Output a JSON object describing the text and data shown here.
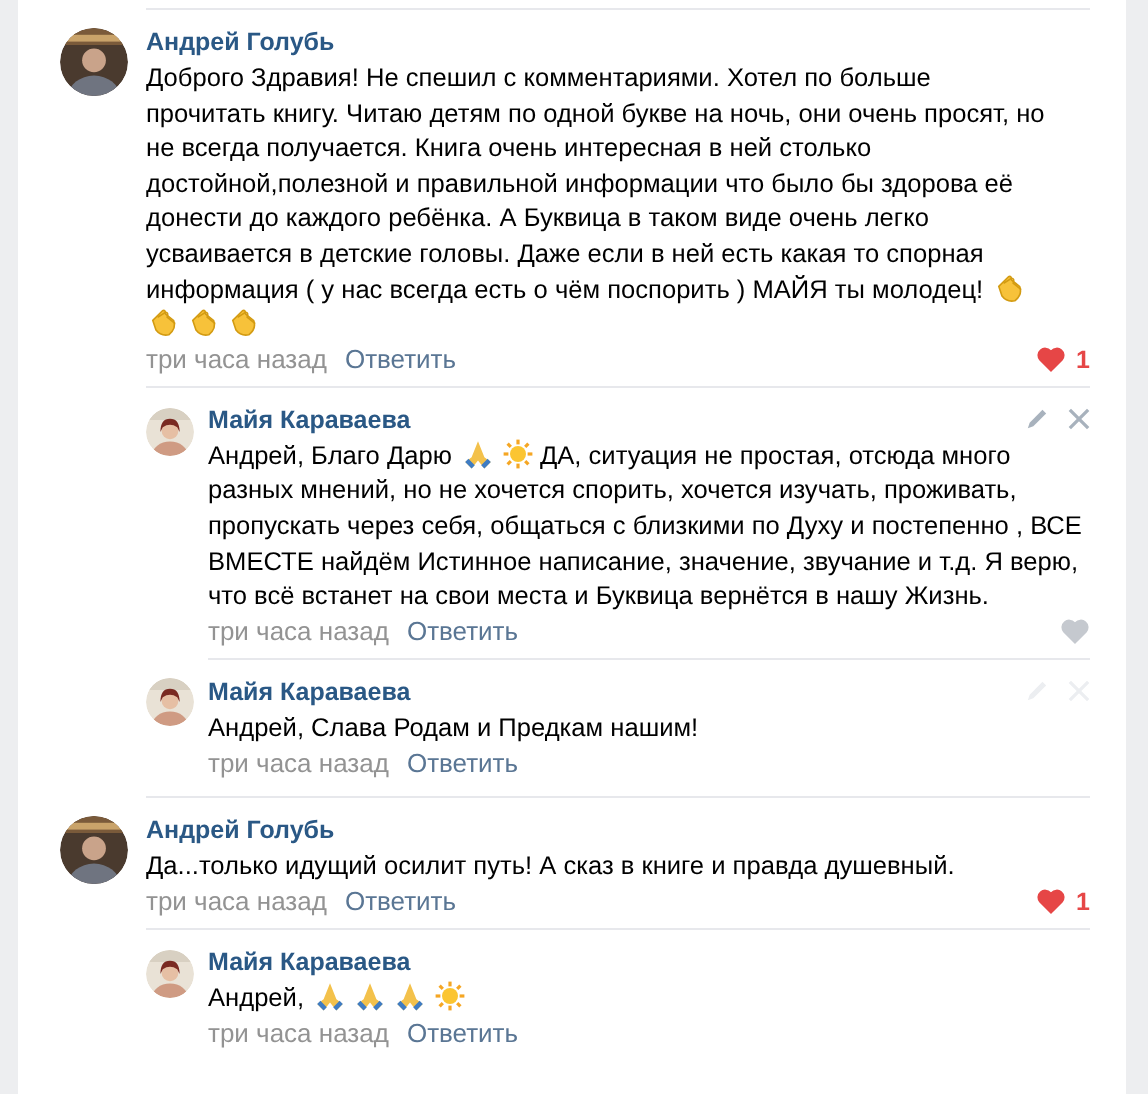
{
  "comments": [
    {
      "author": "Андрей Голубь",
      "body": [
        {
          "kind": "text",
          "text": "Доброго Здравия! Не спешил с комментариями. Хотел по больше прочитать книгу. Читаю детям по одной букве на ночь, они очень просят, но не всегда получается. Книга очень интересная в ней столько достойной,полезной и правильной информации что было бы здорова её донести до каждого ребёнка. А Буквица в таком виде очень легко усваивается в детские головы. Даже если в ней есть какая то спорная"
        },
        {
          "kind": "line",
          "text": "информация ( у нас всегда есть о чём поспорить ) МАЙЯ ты молодец!"
        },
        {
          "kind": "clap"
        },
        {
          "kind": "clap"
        },
        {
          "kind": "clap"
        },
        {
          "kind": "clap"
        }
      ],
      "time": "три часа назад",
      "reply": "Ответить",
      "likes": {
        "liked": true,
        "count": "1"
      },
      "replies": [
        {
          "author": "Майя Караваева",
          "hovered": true,
          "body": [
            {
              "kind": "line",
              "text": "Андрей, Благо Дарю"
            },
            {
              "kind": "pray"
            },
            {
              "kind": "sun"
            },
            {
              "kind": "line",
              "text": "ДА, ситуация не простая, отсюда много"
            },
            {
              "kind": "text",
              "text": "разных мнений, но не хочется спорить, хочется изучать, проживать, пропускать через себя, общаться с близкими по Духу и постепенно , ВСЕ ВМЕСТЕ найдём Истинное написание, значение, звучание и т.д. Я верю, что всё встанет на свои места и Буквица вернётся в нашу Жизнь."
            }
          ],
          "time": "три часа назад",
          "reply": "Ответить",
          "likes": {
            "liked": false
          }
        },
        {
          "author": "Майя Караваева",
          "hovered": false,
          "body": [
            {
              "kind": "line",
              "text": "Андрей, Слава Родам и Предкам нашим!"
            }
          ],
          "time": "три часа назад",
          "reply": "Ответить"
        }
      ]
    },
    {
      "author": "Андрей Голубь",
      "body": [
        {
          "kind": "line",
          "text": "Да...только идущий осилит путь! А сказ в книге и правда душевный."
        }
      ],
      "time": "три часа назад",
      "reply": "Ответить",
      "likes": {
        "liked": true,
        "count": "1"
      },
      "replies": [
        {
          "author": "Майя Караваева",
          "body": [
            {
              "kind": "line",
              "text": "Андрей,"
            },
            {
              "kind": "pray"
            },
            {
              "kind": "pray"
            },
            {
              "kind": "pray"
            },
            {
              "kind": "sun"
            }
          ],
          "time": "три часа назад",
          "reply": "Ответить"
        }
      ]
    }
  ]
}
